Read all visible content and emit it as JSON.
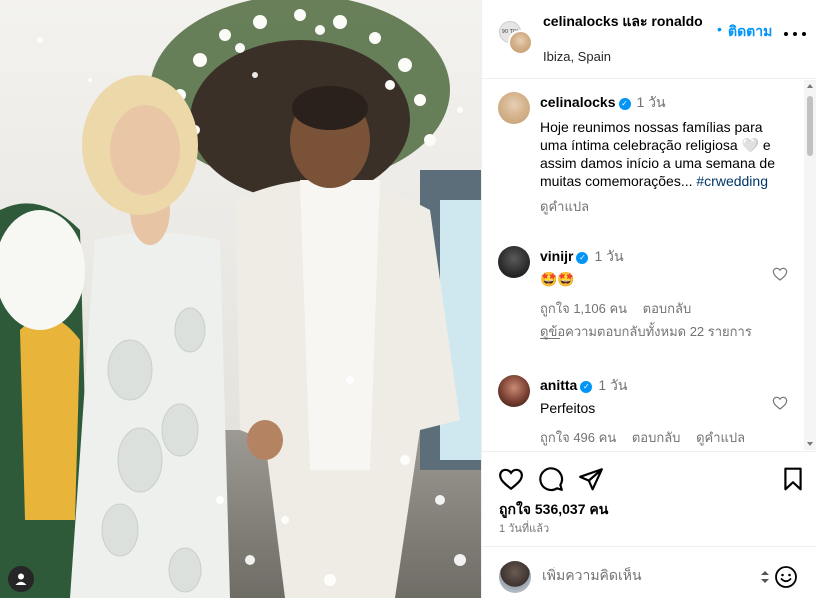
{
  "post": {
    "header": {
      "avatar_tag": "90 TOI",
      "names": "celinalocks และ ronaldo",
      "location": "Ibiza, Spain",
      "follow_dot": "•",
      "follow_label": "ติดตาม"
    },
    "comments": [
      {
        "username": "celinalocks",
        "verified": true,
        "time": "1 วัน",
        "text": "Hoje reunimos nossas famílias para uma íntima celebração religiosa 🤍 e assim damos início a uma semana de muitas comemorações...",
        "hashtag": "#crwedding",
        "translate": "ดูคำแปล"
      },
      {
        "username": "vinijr",
        "verified": true,
        "time": "1 วัน",
        "text": "🤩🤩",
        "likes": "ถูกใจ 1,106 คน",
        "reply": "ตอบกลับ"
      },
      {
        "username": "anitta",
        "verified": true,
        "time": "1 วัน",
        "text": "Perfeitos",
        "likes": "ถูกใจ 496 คน",
        "reply": "ตอบกลับ",
        "translate": "ดูคำแปล"
      }
    ],
    "view_replies": "ดูข้อความตอบกลับทั้งหมด 22 รายการ",
    "likes_total": "ถูกใจ 536,037 คน",
    "posted_ago": "1 วันที่แล้ว",
    "add_comment_placeholder": "เพิ่มความคิดเห็น"
  },
  "icons": {
    "like": "heart-icon",
    "comment": "comment-icon",
    "share": "paper-plane-icon",
    "save": "bookmark-icon",
    "emoji": "emoji-icon",
    "tag": "user-tag-icon",
    "more": "more-icon"
  },
  "colors": {
    "accent": "#0095f6",
    "verified": "#0095f6",
    "hashtag": "#00376b",
    "muted": "#737373"
  }
}
